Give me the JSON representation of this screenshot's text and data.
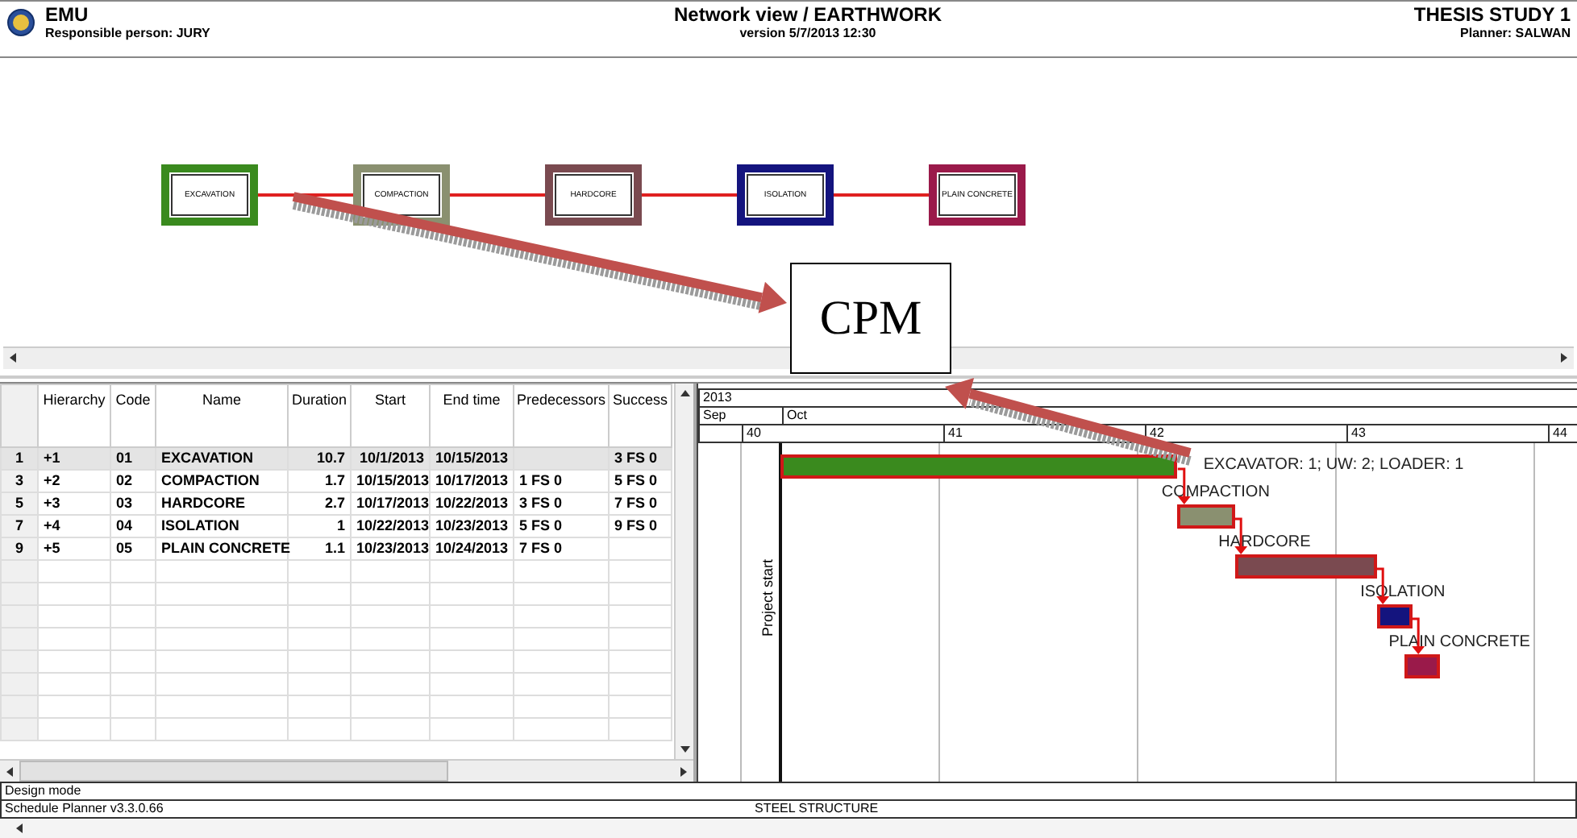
{
  "header": {
    "logo_title": "EMU",
    "responsible": "Responsible person: JURY",
    "title": "Network view / EARTHWORK",
    "version": "version 5/7/2013 12:30",
    "study": "THESIS STUDY 1",
    "planner": "Planner: SALWAN"
  },
  "network": {
    "nodes": [
      {
        "label": "EXCAVATION",
        "color": "#3a8a1e"
      },
      {
        "label": "COMPACTION",
        "color": "#8a9070"
      },
      {
        "label": "HARDCORE",
        "color": "#7a4a50"
      },
      {
        "label": "ISOLATION",
        "color": "#14147e"
      },
      {
        "label": "PLAIN CONCRETE",
        "color": "#9a1a4a"
      }
    ]
  },
  "annotation": {
    "label": "CPM"
  },
  "table": {
    "columns": [
      "Hierarchy",
      "Code",
      "Name",
      "Duration",
      "Start",
      "End time",
      "Predecessors",
      "Success"
    ],
    "rows": [
      {
        "row": "1",
        "hierarchy": "+1",
        "code": "01",
        "name": "EXCAVATION",
        "duration": "10.7",
        "start": "10/1/2013",
        "end_time": "10/15/2013",
        "successors": "3 FS 0",
        "selected": true
      },
      {
        "row": "3",
        "hierarchy": "+2",
        "code": "02",
        "name": "COMPACTION",
        "duration": "1.7",
        "start": "10/15/2013",
        "end_time": "10/17/2013",
        "predecessors": "1 FS 0",
        "successors": "5 FS 0",
        "selected": false
      },
      {
        "row": "5",
        "hierarchy": "+3",
        "code": "03",
        "name": "HARDCORE",
        "duration": "2.7",
        "start": "10/17/2013",
        "end_time": "10/22/2013",
        "predecessors": "3 FS 0",
        "successors": "7 FS 0",
        "selected": false
      },
      {
        "row": "7",
        "hierarchy": "+4",
        "code": "04",
        "name": "ISOLATION",
        "duration": "1",
        "start": "10/22/2013",
        "end_time": "10/23/2013",
        "predecessors": "5 FS 0",
        "successors": "9 FS 0",
        "selected": false
      },
      {
        "row": "9",
        "hierarchy": "+5",
        "code": "05",
        "name": "PLAIN CONCRETE",
        "duration": "1.1",
        "start": "10/23/2013",
        "end_time": "10/24/2013",
        "predecessors": "7 FS 0",
        "selected": false
      }
    ]
  },
  "gantt": {
    "year": "2013",
    "months": [
      "Sep",
      "Oct"
    ],
    "weeks": [
      "40",
      "41",
      "42",
      "43",
      "44"
    ],
    "milestone": "Project start",
    "bars": [
      {
        "note": "EXCAVATOR: 1; UW: 2; LOADER: 1",
        "color": "#3a8a1e"
      },
      {
        "label": "COMPACTION",
        "color": "#8a9070"
      },
      {
        "label": "HARDCORE",
        "color": "#7a4a50"
      },
      {
        "label": "ISOLATION",
        "color": "#14147e"
      },
      {
        "label": "PLAIN CONCRETE",
        "color": "#9a1a4a"
      }
    ]
  },
  "status": {
    "mode": "Design mode",
    "version": "Schedule Planner v3.3.0.66",
    "project": "STEEL STRUCTURE"
  }
}
